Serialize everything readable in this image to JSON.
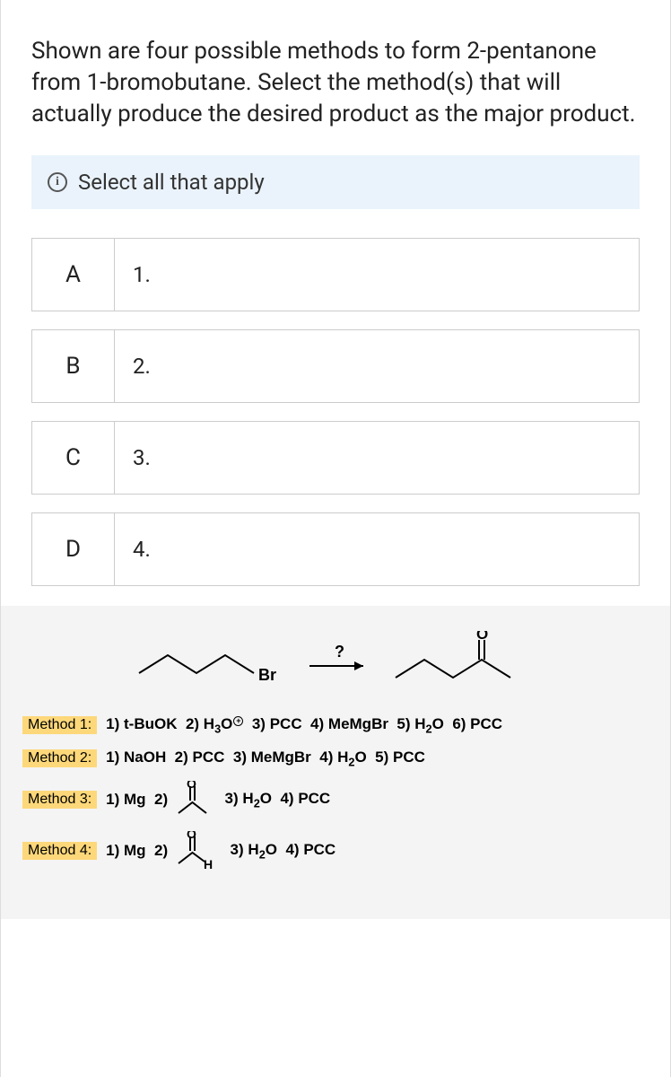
{
  "question": "Shown are four possible methods to form 2-pentanone from 1-bromobutane. Select the method(s) that will actually produce the desired product as the major product.",
  "hint": "Select all that apply",
  "options": [
    {
      "letter": "A",
      "label": "1."
    },
    {
      "letter": "B",
      "label": "2."
    },
    {
      "letter": "C",
      "label": "3."
    },
    {
      "letter": "D",
      "label": "4."
    }
  ],
  "reaction": {
    "reactant_label": "Br",
    "arrow_label": "?"
  },
  "methods": [
    {
      "tag": "Method 1:",
      "steps_html": "1) t-<b>BuOK</b>&nbsp; 2) <b>H<span class='sub'>3</span>O</b><span class='plus-circle'>+</span>&nbsp; 3) <b>PCC</b>&nbsp; 4) <b>MeMgBr</b>&nbsp; 5) <b>H<span class='sub'>2</span>O</b>&nbsp; 6) <b>PCC</b>"
    },
    {
      "tag": "Method 2:",
      "steps_html": "1) <b>NaOH</b>&nbsp; 2) <b>PCC</b>&nbsp; 3) <b>MeMgBr</b>&nbsp; 4) <b>H<span class='sub'>2</span>O</b>&nbsp; 5) <b>PCC</b>"
    },
    {
      "tag": "Method 3:",
      "steps_html": "1) <b>Mg</b>&nbsp; 2) ",
      "has_icon": "acetone",
      "steps_tail": "&nbsp; 3) <b>H<span class='sub'>2</span>O</b>&nbsp; 4) <b>PCC</b>"
    },
    {
      "tag": "Method 4:",
      "steps_html": "1) <b>Mg</b>&nbsp; 2) ",
      "has_icon": "acetaldehyde",
      "steps_tail": "&nbsp; 3) <b>H<span class='sub'>2</span>O</b>&nbsp; 4) <b>PCC</b>"
    }
  ]
}
